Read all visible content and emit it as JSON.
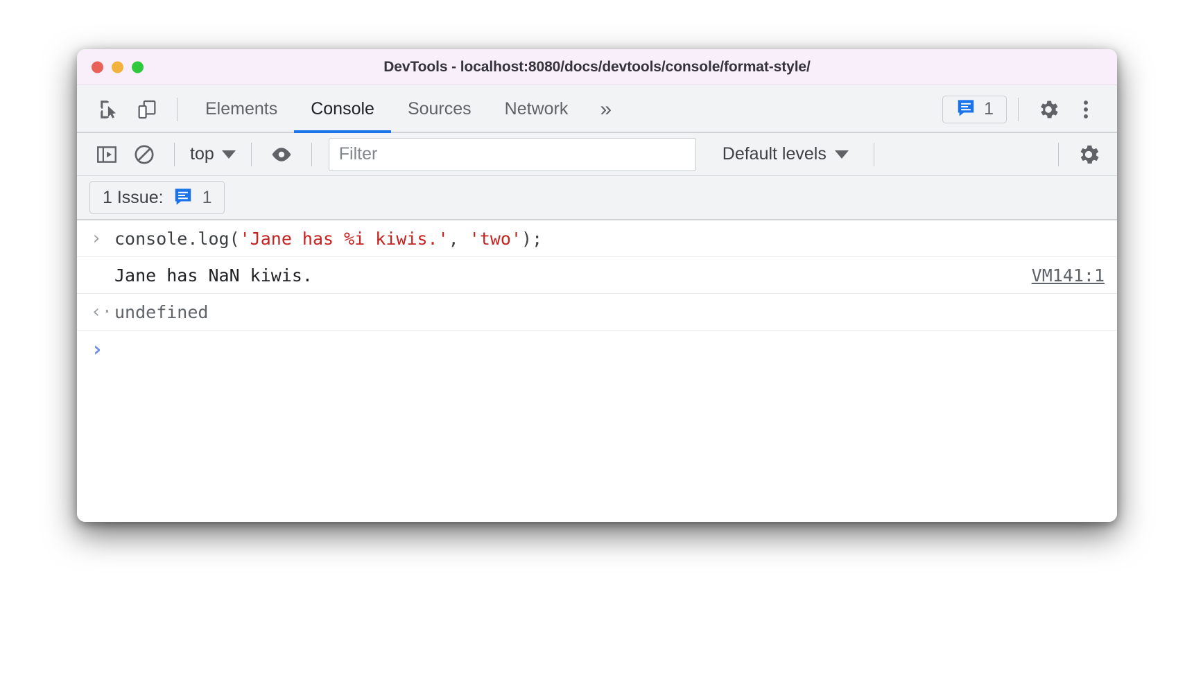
{
  "window": {
    "title": "DevTools - localhost:8080/docs/devtools/console/format-style/",
    "traffic_lights": {
      "close": "close-button",
      "minimize": "minimize-button",
      "maximize": "maximize-button"
    }
  },
  "tabbar": {
    "inspect_icon": "inspect-element-icon",
    "device_icon": "device-toolbar-icon",
    "tabs": [
      {
        "label": "Elements",
        "active": false
      },
      {
        "label": "Console",
        "active": true
      },
      {
        "label": "Sources",
        "active": false
      },
      {
        "label": "Network",
        "active": false
      }
    ],
    "more_tabs_label": "»",
    "issues_badge": {
      "icon": "issues-speech-bubble-icon",
      "count": "1"
    },
    "settings_icon": "gear-icon",
    "menu_icon": "kebab-menu-icon"
  },
  "console_toolbar": {
    "sidebar_icon": "console-sidebar-icon",
    "clear_icon": "clear-console-icon",
    "context": "top",
    "context_caret": "chevron-down-icon",
    "live_expression_icon": "eye-icon",
    "filter": {
      "value": "",
      "placeholder": "Filter"
    },
    "levels": "Default levels",
    "levels_caret": "chevron-down-icon",
    "settings_icon": "gear-icon"
  },
  "issues_bar": {
    "label": "1 Issue:",
    "icon": "issues-speech-bubble-icon",
    "count": "1"
  },
  "console": {
    "input_row": {
      "gutter": "›",
      "parts": [
        {
          "text": "console.log(",
          "type": "code"
        },
        {
          "text": "'Jane has %i kiwis.'",
          "type": "string"
        },
        {
          "text": ", ",
          "type": "code"
        },
        {
          "text": "'two'",
          "type": "string"
        },
        {
          "text": ");",
          "type": "code"
        }
      ],
      "plain": "console.log('Jane has %i kiwis.', 'two');"
    },
    "output_row": {
      "text": "Jane has NaN kiwis.",
      "source": "VM141:1"
    },
    "return_row": {
      "gutter": "‹·",
      "text": "undefined"
    },
    "prompt": {
      "caret": "›",
      "value": ""
    }
  },
  "colors": {
    "accent_blue": "#1a73e8",
    "string_red": "#c5221f",
    "titlebar_bg": "#f8effa",
    "toolbar_bg": "#f1f3f4",
    "body_bg": "#ffffff",
    "prompt_blue": "#6c8eef"
  }
}
